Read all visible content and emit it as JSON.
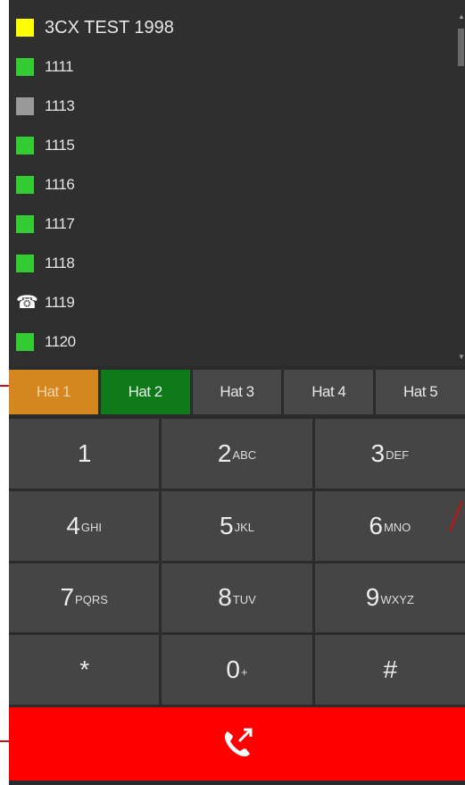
{
  "contacts": [
    {
      "label": "3CX TEST 1998",
      "status": "#ffff00"
    },
    {
      "label": "1111",
      "status": "#33cc33"
    },
    {
      "label": "1113",
      "status": "#999999"
    },
    {
      "label": "1115",
      "status": "#33cc33"
    },
    {
      "label": "1116",
      "status": "#33cc33"
    },
    {
      "label": "1117",
      "status": "#33cc33"
    },
    {
      "label": "1118",
      "status": "#33cc33"
    },
    {
      "label": "1119",
      "status": "phone-icon"
    },
    {
      "label": "1120",
      "status": "#33cc33"
    }
  ],
  "tabs": [
    "Hat 1",
    "Hat 2",
    "Hat 3",
    "Hat 4",
    "Hat 5"
  ],
  "keypad": [
    {
      "digit": "1",
      "letters": ""
    },
    {
      "digit": "2",
      "letters": "ABC"
    },
    {
      "digit": "3",
      "letters": "DEF"
    },
    {
      "digit": "4",
      "letters": "GHI"
    },
    {
      "digit": "5",
      "letters": "JKL"
    },
    {
      "digit": "6",
      "letters": "MNO"
    },
    {
      "digit": "7",
      "letters": "PQRS"
    },
    {
      "digit": "8",
      "letters": "TUV"
    },
    {
      "digit": "9",
      "letters": "WXYZ"
    },
    {
      "digit": "*",
      "letters": ""
    },
    {
      "digit": "0",
      "letters": "+"
    },
    {
      "digit": "#",
      "letters": ""
    }
  ],
  "colors": {
    "tab_active_orange": "#d4861f",
    "tab_active_green": "#0e7a1a",
    "hangup": "#ff0000",
    "panel": "#2f2f2f",
    "key": "#454545"
  },
  "hangup_icon": "hangup-phone-icon"
}
